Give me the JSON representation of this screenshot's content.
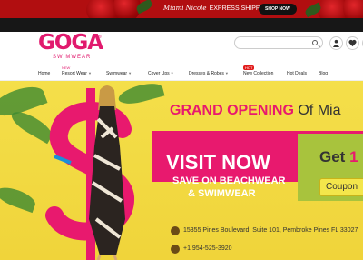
{
  "topbar": {
    "promo_script": "Miami Nicole",
    "promo_text": "EXPRESS SHIPPING",
    "shop_now": "SHOP NOW"
  },
  "logo": {
    "name": "GOGA",
    "reg": "®",
    "sub": "SWIMWEAR"
  },
  "search": {
    "placeholder": ""
  },
  "nav": {
    "items": [
      {
        "label": "Home"
      },
      {
        "label": "Resort Wear",
        "badge": "NEW"
      },
      {
        "label": "Swimwear"
      },
      {
        "label": "Cover Ups"
      },
      {
        "label": "Dresses & Robes"
      },
      {
        "label": "New Collection",
        "badge": "HOT"
      },
      {
        "label": "Hot Deals"
      },
      {
        "label": "Blog"
      }
    ]
  },
  "hero": {
    "grand_opening": "GRAND OPENING",
    "of_city": "Of Mia",
    "visit_now": "VISIT NOW",
    "save_line": "SAVE ON BEACHWEAR",
    "swim_line": "& SWIMWEAR",
    "get_text": "Get",
    "get_number": "1",
    "coupon": "Coupon",
    "address": "15355 Pines Boulevard, Suite 101, Pembroke Pines FL 33027",
    "phone": "+1 954-525-3920"
  },
  "colors": {
    "brand_pink": "#e11a6e",
    "hero_yellow": "#f2d83e",
    "topbar_red": "#b10e10",
    "accent_green": "#a8c33d"
  },
  "icons": [
    "search-icon",
    "user-icon",
    "heart-icon",
    "cart-icon",
    "location-pin-icon",
    "phone-icon"
  ]
}
